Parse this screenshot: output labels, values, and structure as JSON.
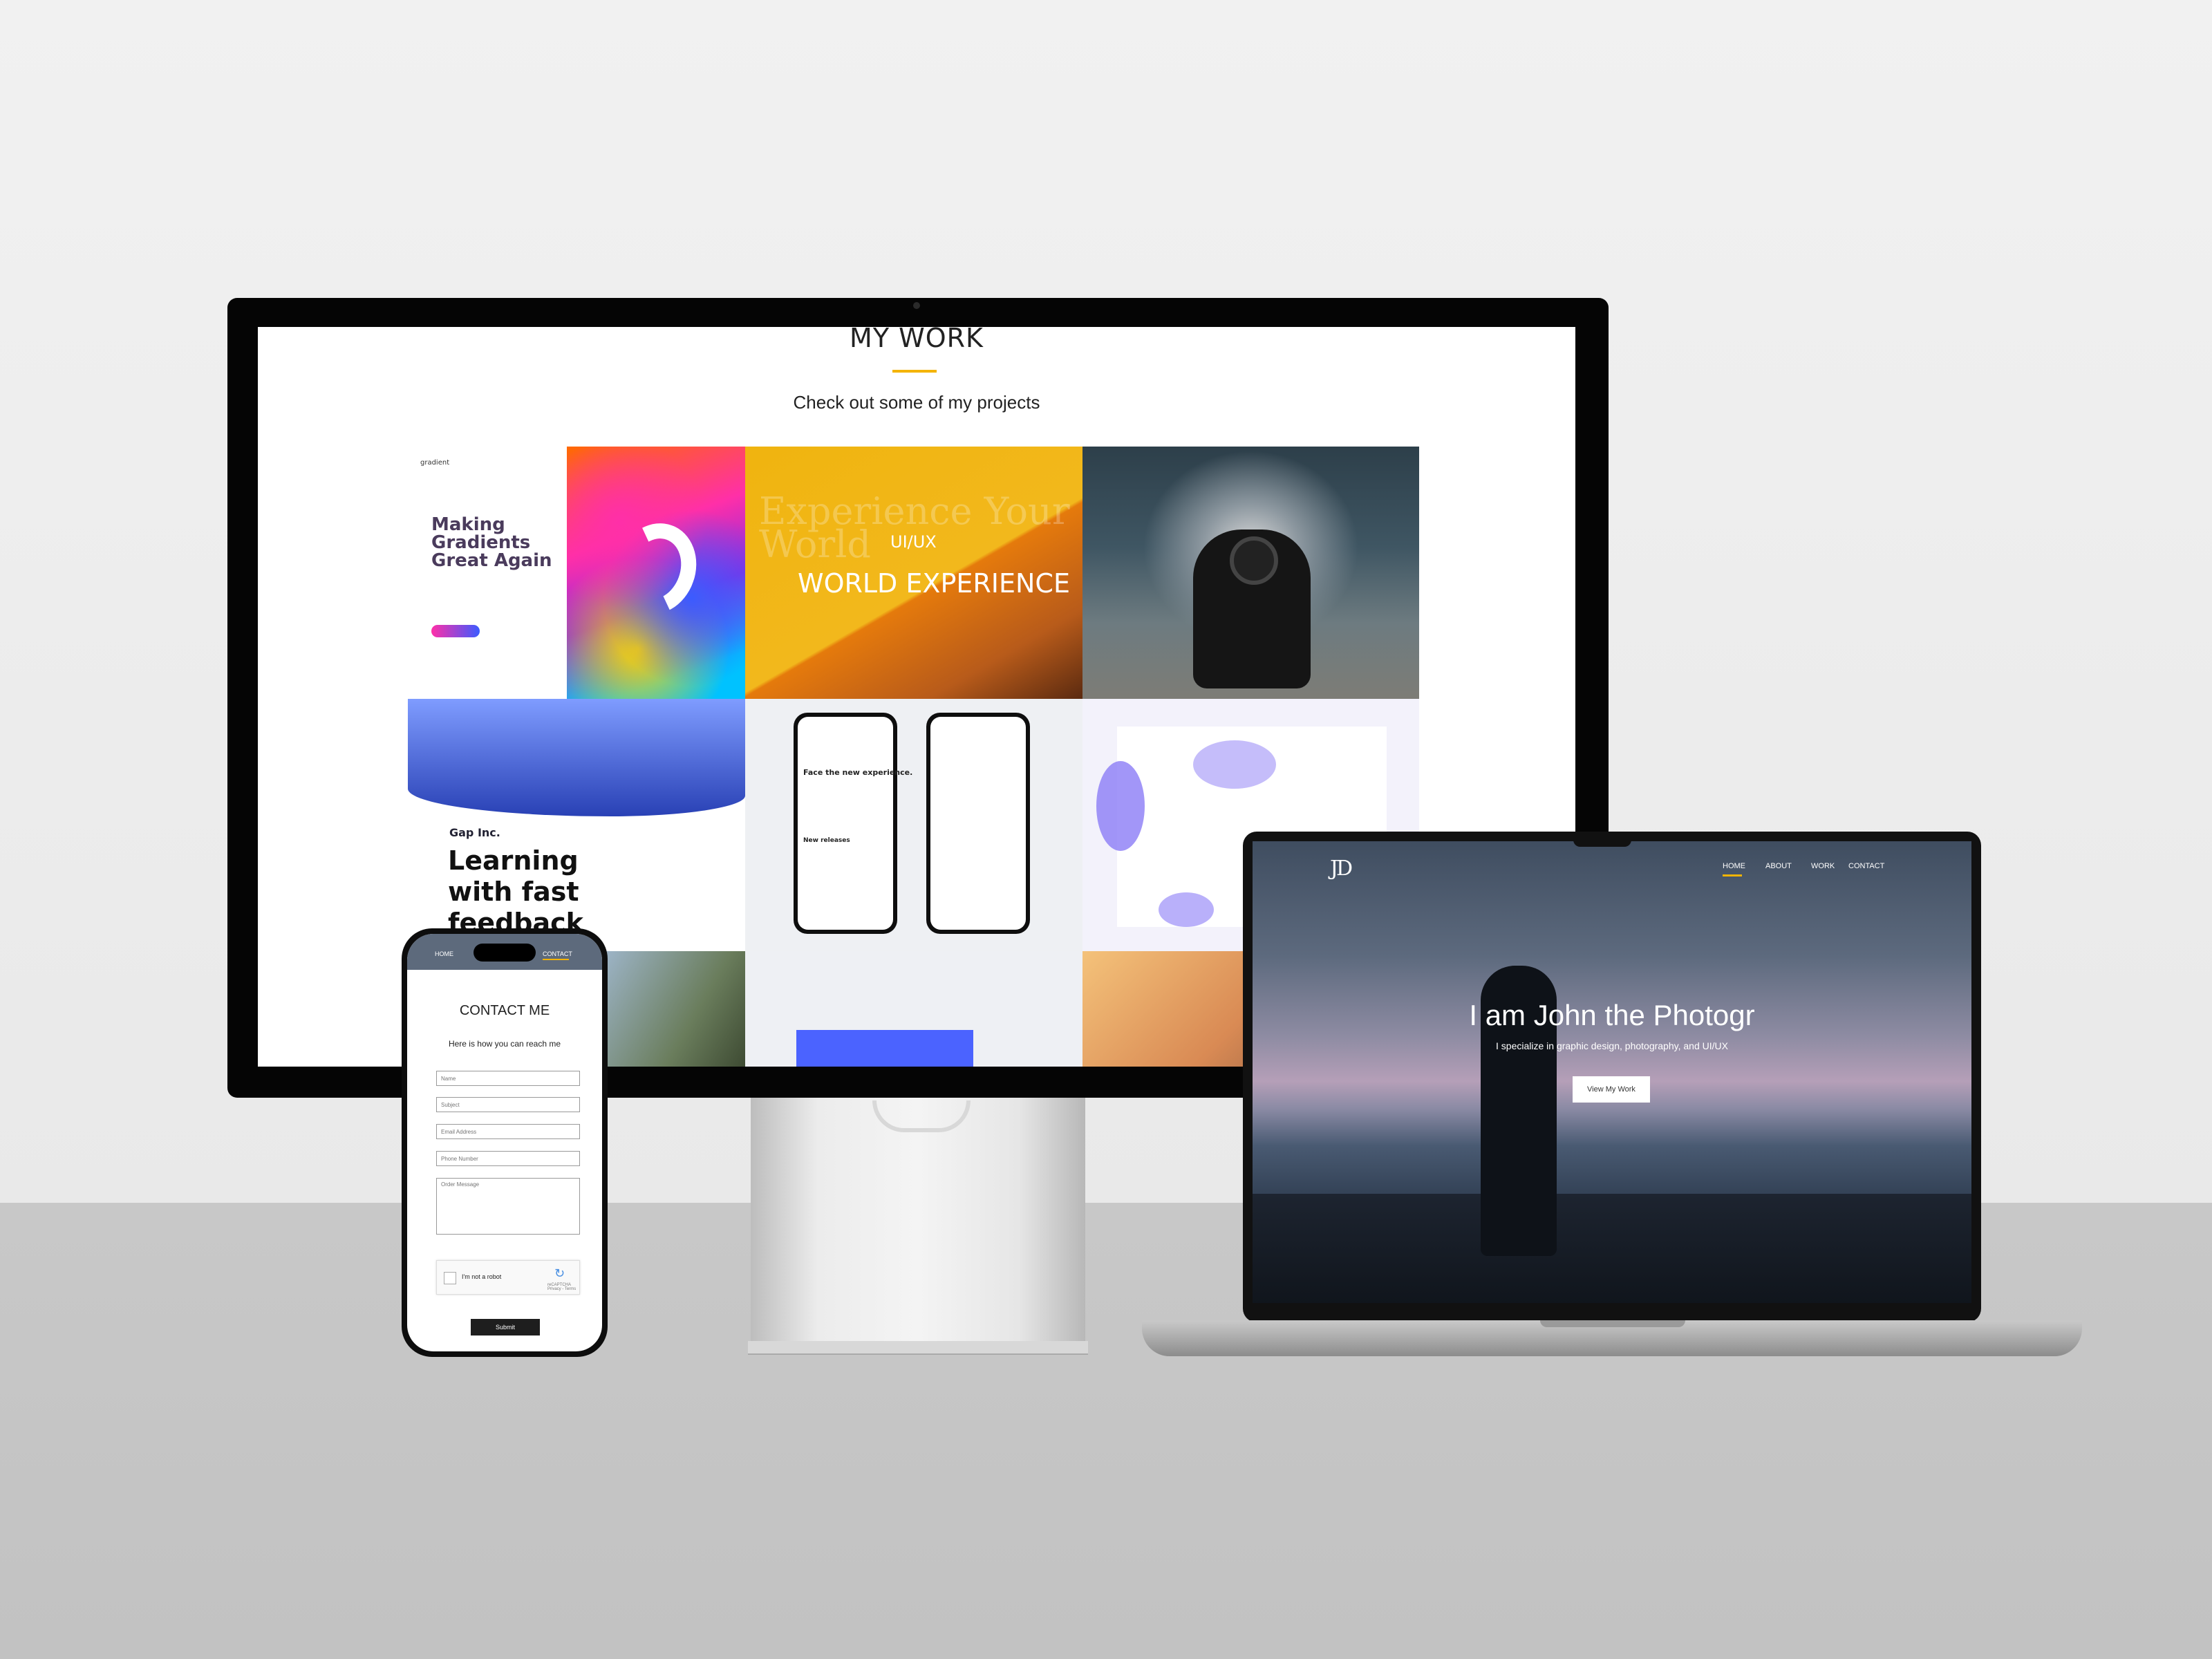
{
  "monitor": {
    "section_title": "MY WORK",
    "section_subtitle": "Check out some of my projects",
    "tiles": {
      "gradients": {
        "logo": "gradient",
        "headline": "Making Gradients Great Again"
      },
      "uiux": {
        "background_text": "Experience Your World",
        "small": "UI/UX",
        "big": "WORLD EXPERIENCE"
      },
      "gap": {
        "brand": "Gap Inc.",
        "headline": "Learning with fast feedback"
      },
      "phones": {
        "text1": "Face the new experience.",
        "text2": "New releases"
      }
    }
  },
  "laptop": {
    "logo": "JD",
    "nav": [
      "HOME",
      "ABOUT",
      "WORK",
      "CONTACT"
    ],
    "active_nav": "HOME",
    "hero_title": "I am John the Photogr",
    "hero_subtitle": "I specialize in graphic design, photography, and UI/UX",
    "cta_label": "View My Work"
  },
  "phone": {
    "nav_home": "HOME",
    "nav_contact": "CONTACT",
    "title": "CONTACT ME",
    "subtitle": "Here is how you can reach me",
    "fields": {
      "name": "Name",
      "subject": "Subject",
      "email": "Email Address",
      "phone": "Phone Number",
      "message": "Order Message"
    },
    "captcha_label": "I'm not a robot",
    "captcha_brand": "reCAPTCHA Privacy - Terms",
    "submit_label": "Submit"
  },
  "colors": {
    "accent": "#f4b400",
    "dark": "#1e1e1e"
  }
}
